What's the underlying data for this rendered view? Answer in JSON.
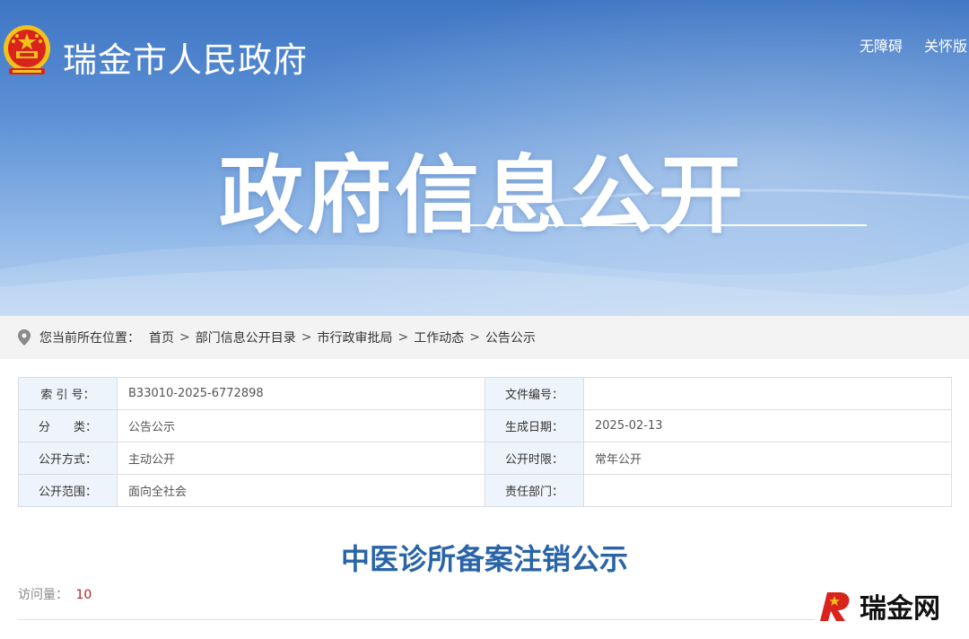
{
  "header": {
    "site_title": "瑞金市人民政府",
    "links": {
      "accessibility": "无障碍",
      "care_mode": "关怀版"
    },
    "hero_title": "政府信息公开",
    "emblem_icon": "national-emblem-icon"
  },
  "breadcrumb": {
    "icon": "location-pin-icon",
    "prefix": "您当前所在位置：",
    "items": [
      "首页",
      "部门信息公开目录",
      "市行政审批局",
      "工作动态",
      "公告公示"
    ],
    "separator": ">"
  },
  "metadata": {
    "rows": [
      {
        "left_label": "索 引 号：",
        "left_value": "B33010-2025-6772898",
        "right_label": "文件编号：",
        "right_value": ""
      },
      {
        "left_label": "分　　类：",
        "left_value": "公告公示",
        "right_label": "生成日期：",
        "right_value": "2025-02-13"
      },
      {
        "left_label": "公开方式：",
        "left_value": "主动公开",
        "right_label": "公开时限：",
        "right_value": "常年公开"
      },
      {
        "left_label": "公开范围：",
        "left_value": "面向全社会",
        "right_label": "责任部门：",
        "right_value": ""
      }
    ]
  },
  "article": {
    "title": "中医诊所备案注销公示",
    "visits_label": "访问量：",
    "visits_count": "10"
  },
  "watermark": {
    "text": "瑞金网"
  },
  "colors": {
    "banner_top": "#3f76c4",
    "banner_bottom": "#b5d2f2",
    "title_blue": "#2a64a8",
    "label_bg": "#eef4fb",
    "visit_red": "#b22222",
    "watermark_red": "#d8241c"
  }
}
